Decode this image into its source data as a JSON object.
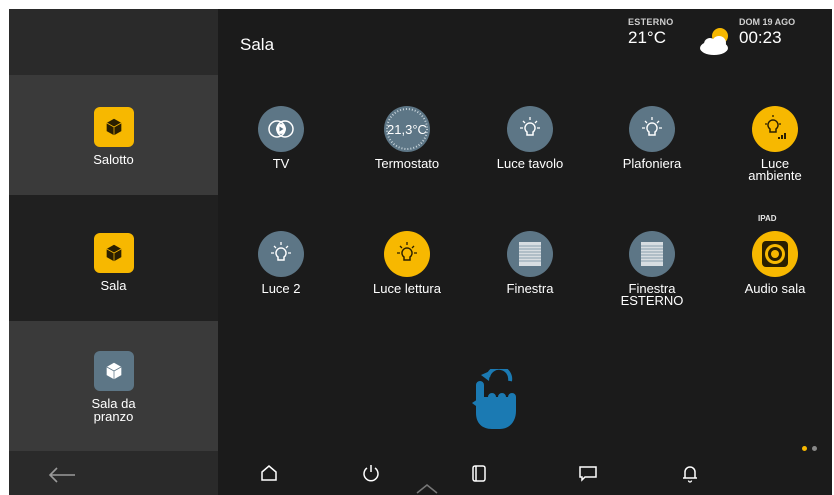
{
  "header": {
    "room_title": "Sala",
    "weather_label": "ESTERNO",
    "temperature": "21°C",
    "weather_icon": "partly-cloudy-icon",
    "date": "DOM 19 AGO",
    "time": "00:23"
  },
  "sidebar": {
    "rooms": [
      {
        "label": "Salotto",
        "icon": "cube-icon",
        "color": "#f7b800"
      },
      {
        "label": "Sala",
        "icon": "cube-icon",
        "color": "#f7b800",
        "selected": true
      },
      {
        "label_line1": "Sala da",
        "label_line2": "pranzo",
        "icon": "cube-icon",
        "color": "#5d7686"
      }
    ],
    "back_icon": "arrow-left-icon"
  },
  "devices": [
    {
      "label": "TV",
      "icon": "tv-play-icon",
      "state": "off"
    },
    {
      "label": "Termostato",
      "value": "21,3°C",
      "icon": "thermostat-dial-icon",
      "state": "off"
    },
    {
      "label": "Luce tavolo",
      "icon": "bulb-icon",
      "state": "off"
    },
    {
      "label": "Plafoniera",
      "icon": "bulb-icon",
      "state": "off"
    },
    {
      "label_line1": "Luce",
      "label_line2": "ambiente",
      "icon": "dimmer-bulb-icon",
      "state": "on"
    },
    {
      "label": "Luce 2",
      "icon": "bulb-icon",
      "state": "off"
    },
    {
      "label": "Luce lettura",
      "icon": "bulb-icon",
      "state": "on"
    },
    {
      "label": "Finestra",
      "icon": "shutter-icon",
      "state": "off"
    },
    {
      "label_line1": "Finestra",
      "label_line2": "ESTERNO",
      "icon": "shutter-icon",
      "state": "off"
    },
    {
      "label": "Audio sala",
      "tag": "IPAD",
      "icon": "speaker-icon",
      "state": "on"
    }
  ],
  "swipe_hint_icon": "swipe-hand-icon",
  "pagination": {
    "pages": 2,
    "current": 1
  },
  "bottom_nav": [
    "home-icon",
    "power-icon",
    "scenes-icon",
    "chat-icon",
    "bell-icon",
    "chevron-up-icon"
  ],
  "colors": {
    "accent": "#f7b800",
    "inactive": "#5d7686",
    "background": "#1b1b1b",
    "sidebar": "#2a2a2a"
  }
}
